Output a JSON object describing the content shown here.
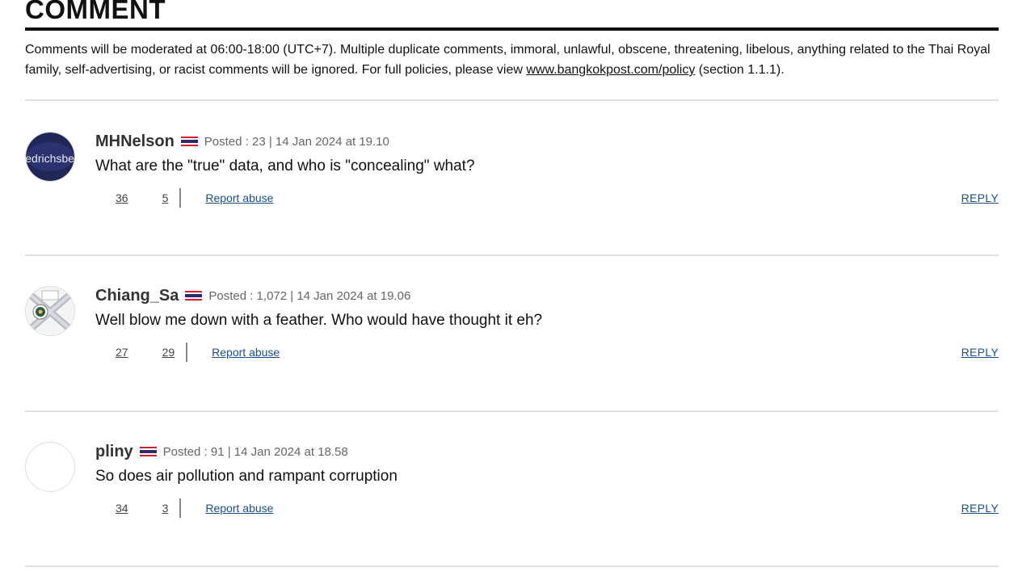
{
  "section_title": "COMMENT",
  "notice": {
    "text_before": "Comments will be moderated at 06:00-18:00 (UTC+7). Multiple duplicate comments, immoral, unlawful, obscene, threatening, libelous, anything related to the Thai Royal family, self-advertising, or racist comments will be ignored. For full policies, please view ",
    "link_text": "www.bangkokpost.com/policy",
    "text_after": " (section 1.1.1)."
  },
  "comments": [
    {
      "username": "MHNelson",
      "meta": "Posted : 23 | 14 Jan 2024 at 19.10",
      "body": "What are the \"true\" data, and who is \"concealing\" what?",
      "upvotes": "36",
      "downvotes": "5",
      "report_label": "Report abuse",
      "reply_label": "REPLY",
      "avatar_text": "friedrichsberg"
    },
    {
      "username": "Chiang_Sa",
      "meta": "Posted : 1,072 | 14 Jan 2024 at 19.06",
      "body": "Well blow me down with a feather. Who would have thought it eh?",
      "upvotes": "27",
      "downvotes": "29",
      "report_label": "Report abuse",
      "reply_label": "REPLY"
    },
    {
      "username": "pliny",
      "meta": "Posted : 91 | 14 Jan 2024 at 18.58",
      "body": "So does air pollution and rampant corruption",
      "upvotes": "34",
      "downvotes": "3",
      "report_label": "Report abuse",
      "reply_label": "REPLY"
    }
  ],
  "colors": {
    "flag_red": "#d6202b",
    "flag_white": "#ffffff",
    "flag_blue": "#2d2a6e",
    "link_blue": "#1a4f8b",
    "avatar1_bg": "#1f2756"
  }
}
